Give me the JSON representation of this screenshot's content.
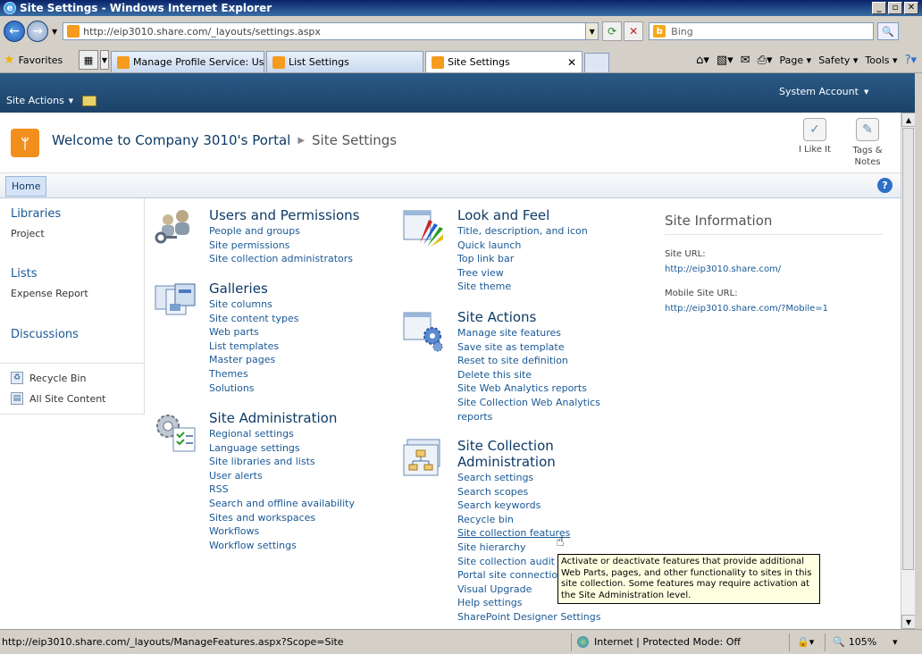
{
  "window": {
    "title": "Site Settings - Windows Internet Explorer"
  },
  "address": {
    "url": "http://eip3010.share.com/_layouts/settings.aspx",
    "search_placeholder": "Bing"
  },
  "favorites": {
    "label": "Favorites"
  },
  "tabs": [
    {
      "label": "Manage Profile Service: User..."
    },
    {
      "label": "List Settings"
    },
    {
      "label": "Site Settings"
    }
  ],
  "commandbar": {
    "page": "Page",
    "safety": "Safety",
    "tools": "Tools"
  },
  "sp": {
    "site_actions": "Site Actions",
    "account": "System Account",
    "welcome": "Welcome to Company 3010's Portal",
    "crumb": "Site Settings",
    "ilike": "I Like It",
    "tags_line1": "Tags &",
    "tags_line2": "Notes",
    "home_tab": "Home"
  },
  "quicklaunch": {
    "libraries": "Libraries",
    "project": "Project",
    "lists": "Lists",
    "expense": "Expense Report",
    "discussions": "Discussions",
    "recycle": "Recycle Bin",
    "all_content": "All Site Content"
  },
  "sections": {
    "users": {
      "title": "Users and Permissions",
      "links": [
        "People and groups",
        "Site permissions",
        "Site collection administrators"
      ]
    },
    "galleries": {
      "title": "Galleries",
      "links": [
        "Site columns",
        "Site content types",
        "Web parts",
        "List templates",
        "Master pages",
        "Themes",
        "Solutions"
      ]
    },
    "admin": {
      "title": "Site Administration",
      "links": [
        "Regional settings",
        "Language settings",
        "Site libraries and lists",
        "User alerts",
        "RSS",
        "Search and offline availability",
        "Sites and workspaces",
        "Workflows",
        "Workflow settings"
      ]
    },
    "look": {
      "title": "Look and Feel",
      "links": [
        "Title, description, and icon",
        "Quick launch",
        "Top link bar",
        "Tree view",
        "Site theme"
      ]
    },
    "actions": {
      "title": "Site Actions",
      "links": [
        "Manage site features",
        "Save site as template",
        "Reset to site definition",
        "Delete this site",
        "Site Web Analytics reports",
        "Site Collection Web Analytics",
        "reports"
      ]
    },
    "collection": {
      "title_line1": "Site Collection",
      "title_line2": "Administration",
      "links": [
        "Search settings",
        "Search scopes",
        "Search keywords",
        "Recycle bin",
        "Site collection features",
        "Site hierarchy",
        "Site collection audit",
        "Portal site connectio",
        "Visual Upgrade",
        "Help settings",
        "SharePoint Designer Settings"
      ]
    }
  },
  "site_info": {
    "title": "Site Information",
    "url_label": "Site URL:",
    "url_value": "http://eip3010.share.com/",
    "mobile_label": "Mobile Site URL:",
    "mobile_value": "http://eip3010.share.com/?Mobile=1"
  },
  "tooltip": "Activate or deactivate features that provide additional Web Parts, pages, and other functionality to sites in this site collection. Some features may require activation at the Site Administration level.",
  "status": {
    "url": "http://eip3010.share.com/_layouts/ManageFeatures.aspx?Scope=Site",
    "zone": "Internet | Protected Mode: Off",
    "zoom": "105%"
  }
}
